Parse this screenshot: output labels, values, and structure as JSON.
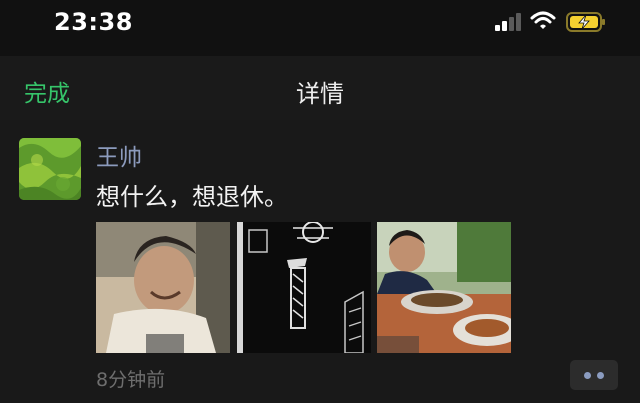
{
  "status_bar": {
    "time": "23:38",
    "signal_icon": "cellular-signal-icon",
    "wifi_icon": "wifi-icon",
    "battery_icon": "battery-charging-icon",
    "battery_color": "#f5d130"
  },
  "nav": {
    "done_label": "完成",
    "title": "详情",
    "accent_color": "#36c56a"
  },
  "post": {
    "author": "王帅",
    "text": "想什么，想退休。",
    "time": "8分钟前",
    "name_color": "#8c9bbd",
    "photos": [
      {
        "icon": "man-laughing-photo"
      },
      {
        "icon": "black-white-artwork-photo"
      },
      {
        "icon": "man-dining-photo"
      }
    ],
    "more_icon": "more-dots-icon"
  }
}
